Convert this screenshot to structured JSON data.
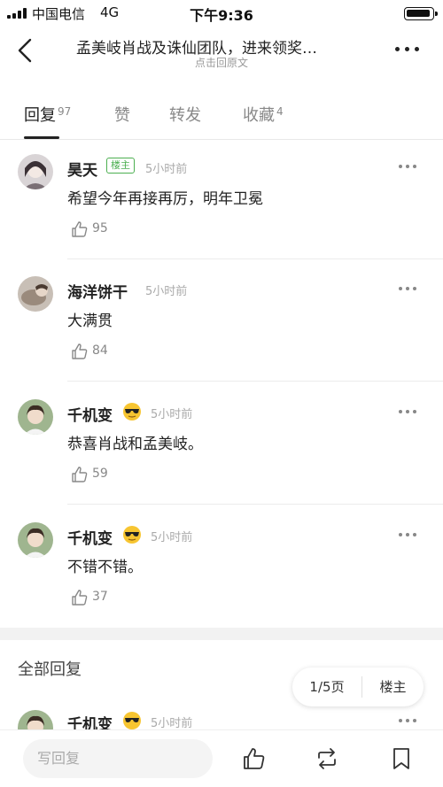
{
  "status_bar": {
    "carrier": "中国电信",
    "network": "4G",
    "time": "下午9:36"
  },
  "header": {
    "title": "孟美岐肖战及诛仙团队，进来领奖…",
    "subtitle": "点击回原文"
  },
  "tabs": [
    {
      "label": "回复",
      "count": "97",
      "active": true
    },
    {
      "label": "赞",
      "count": ""
    },
    {
      "label": "转发",
      "count": ""
    },
    {
      "label": "收藏",
      "count": "4"
    }
  ],
  "comments": [
    {
      "name": "昊天",
      "badge": "楼主",
      "time": "5小时前",
      "text": "希望今年再接再厉，明年卫冕",
      "likes": "95"
    },
    {
      "name": "海洋饼干",
      "time": "5小时前",
      "text": "大满贯",
      "likes": "84"
    },
    {
      "name": "千机变",
      "time": "5小时前",
      "text": "恭喜肖战和孟美岐。",
      "likes": "59",
      "emoji": "sunglasses-emoji"
    },
    {
      "name": "千机变",
      "time": "5小时前",
      "text": "不错不错。",
      "likes": "37",
      "emoji": "sunglasses-emoji"
    }
  ],
  "section_title": "全部回复",
  "partial_comment": {
    "name": "千机变",
    "time": "5小时前",
    "emoji": "sunglasses-emoji"
  },
  "pager": {
    "page": "1/5页",
    "owner_label": "楼主"
  },
  "bottom_bar": {
    "reply_placeholder": "写回复"
  },
  "colors": {
    "badge_green": "#4caf50",
    "divider": "#ececec",
    "muted": "#aaaaaa"
  }
}
